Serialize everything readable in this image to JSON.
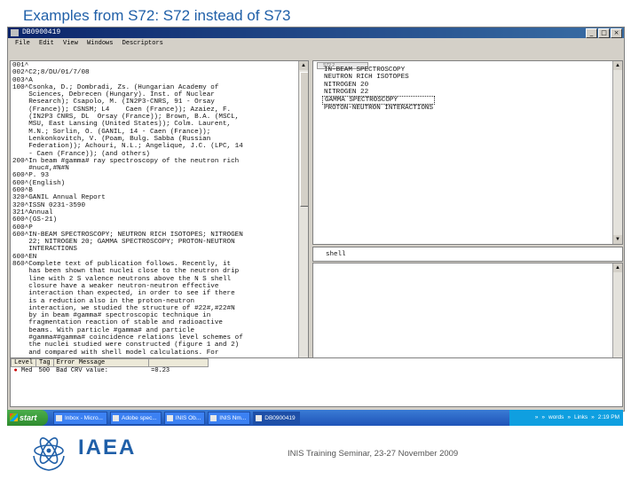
{
  "slide_title": "Examples from S72: S72 instead of S73",
  "window": {
    "title": "DB0900419",
    "menu": [
      "File",
      "Edit",
      "View",
      "Windows",
      "Descriptors"
    ],
    "buttons": [
      "_",
      "□",
      "×"
    ]
  },
  "record_lines": [
    "001^",
    "002^C2;8/DU/01/7/08",
    "003^A",
    "100^Csonka, D.; Dombradi, Zs. (Hungarian Academy of",
    "    Sciences, Debrecen (Hungary). Inst. of Nuclear",
    "    Research); Csapolo, M. (IN2P3-CNRS, 91 - Orsay",
    "    (France)); CSNSM; L4    Caen (France)); Azaiez, F.",
    "    (IN2P3 CNRS, DL  Orsay (France)); Brown, B.A. (MSCL,",
    "    MSU, East Lansing (United States)); Colm. Laurent,",
    "    M.N.; Sorlin, O. (GANIL, 14 - Caen (France));",
    "    Lenkonkovitch, V. (Poam, Bulg. Sabba (Russian",
    "    Federation)); Achouri, N.L.; Angelique, J.C. (LPC, 14",
    "    - Caen (France)); (and others)",
    "200^In beam #gamma# ray spectroscopy of the neutron rich",
    "    #nuc#,#N#N",
    "600^P. 93",
    "600^(English)",
    "600^B",
    "320^GANIL Annual Report",
    "320^ISSN 0231-3590",
    "321^Annual",
    "600^(GS-21)",
    "600^P",
    "600^IN-BEAM SPECTROSCOPY; NEUTRON RICH ISOTOPES; NITROGEN",
    "    22; NITROGEN 20; GAMMA SPECTROSCOPY; PROTON-NEUTRON",
    "    INTERACTIONS",
    "600^EN",
    "860^Complete text of publication follows. Recently, it",
    "    has been shown that nuclei close to the neutron drip",
    "    line with 2 S valence neutrons above the N S shell",
    "    closure have a weaker neutron-neutron effective",
    "    interaction than expected, in order to see if there",
    "    is a reduction also in the proton-neutron",
    "    interaction, we studied the structure of #22#,#22#N",
    "    by in beam #gamma# spectroscopic technique in",
    "    fragmentation reaction of stable and radioactive",
    "    beams. With particle #gamma# and particle",
    "    #gamma##gamma# coincidence relations level schemes of",
    "    the nuclei studied were constructed (figure 1 and 2)",
    "    and compared with shell model calculations. For"
  ],
  "descriptor_tab": "S72 2",
  "descriptor_list": [
    "IN-BEAM SPECTROSCOPY",
    "NEUTRON RICH ISOTOPES",
    "NITROGEN 20",
    "NITROGEN 22",
    "GAMMA SPECTROSCOPY",
    "PROTON-NEUTRON INTERACTIONS"
  ],
  "selected_descriptor_index": 4,
  "search_value": "shell",
  "messages": {
    "headers": [
      "Level",
      "Tag",
      "Error Message"
    ],
    "rows": [
      {
        "level": "Med",
        "tag": "500",
        "message": "Bad CRV value:",
        "value": "=0.23"
      }
    ]
  },
  "taskbar": {
    "start": "start",
    "tasks": [
      "Inbox - Micro...",
      "Adobe spec...",
      "INIS Ob...",
      "INIS Nm...",
      "DB0900419"
    ],
    "tray": [
      "»",
      "»",
      "words",
      "»",
      "Links",
      "»",
      "2:19 PM"
    ]
  },
  "footer": {
    "org": "IAEA",
    "event": "INIS Training Seminar, 23-27 November 2009"
  },
  "colors": {
    "title": "#1f5fa8",
    "taskbar": "#245edb",
    "window_title": "#0a246a"
  }
}
